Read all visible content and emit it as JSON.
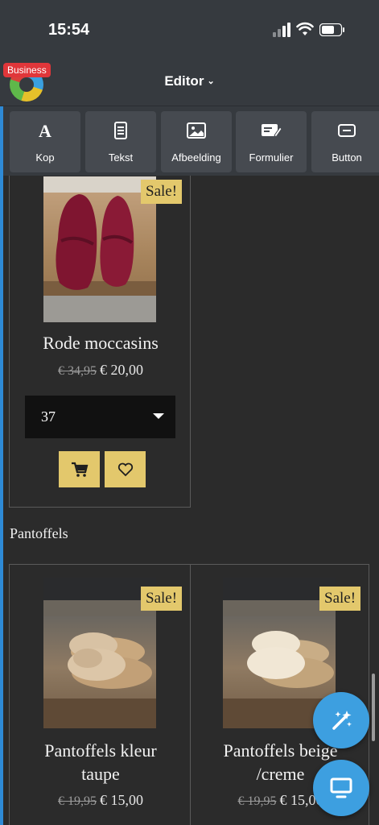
{
  "status_bar": {
    "time": "15:54"
  },
  "header": {
    "badge": "Business",
    "title": "Editor",
    "chevron": "⌄"
  },
  "toolbar": {
    "items": [
      {
        "label": "Kop",
        "icon": "heading-icon"
      },
      {
        "label": "Tekst",
        "icon": "text-icon"
      },
      {
        "label": "Afbeelding",
        "icon": "image-icon"
      },
      {
        "label": "Formulier",
        "icon": "form-icon"
      },
      {
        "label": "Button",
        "icon": "button-icon"
      }
    ]
  },
  "products_top": [
    {
      "name": "Rode moccasins",
      "old_price": "€ 34,95",
      "price": "€ 20,00",
      "badge": "Sale!",
      "size_value": "37"
    }
  ],
  "section": {
    "title": "Pantoffels"
  },
  "products_bottom": [
    {
      "name_line1": "Pantoffels kleur",
      "name_line2": "taupe",
      "old_price": "€ 19,95",
      "price": "€ 15,00",
      "badge": "Sale!"
    },
    {
      "name_line1": "Pantoffels beige",
      "name_line2": "/creme",
      "old_price": "€ 19,95",
      "price": "€ 15,00",
      "badge": "Sale!"
    }
  ],
  "colors": {
    "accent": "#2e8ad6",
    "gold": "#e3c86c",
    "fab": "#3d9fe0",
    "badge_red": "#e0363a"
  }
}
